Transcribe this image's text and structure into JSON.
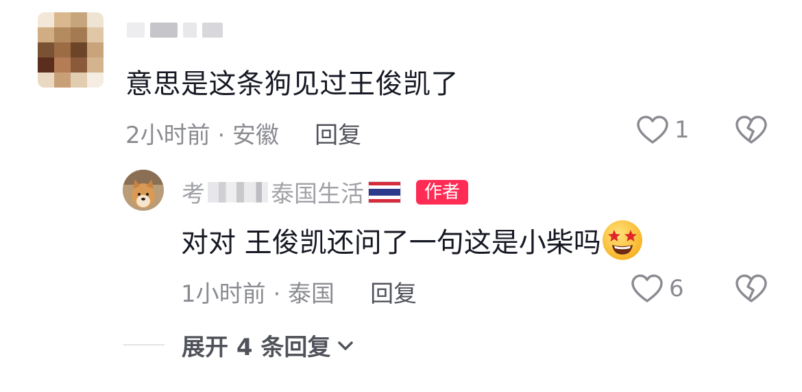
{
  "comment": {
    "text": "意思是这条狗见过王俊凯了",
    "time_location": "2小时前 · 安徽",
    "reply_label": "回复",
    "like_count": "1"
  },
  "reply": {
    "author_prefix": "考",
    "author_suffix": "泰国生活",
    "author_badge": "作者",
    "text": "对对 王俊凯还问了一句这是小柴吗",
    "time_location": "1小时前 · 泰国",
    "reply_label": "回复",
    "like_count": "6"
  },
  "expand": {
    "label": "展开 4 条回复"
  },
  "icons": {
    "like": "heart-outline-icon",
    "dislike": "broken-heart-icon",
    "expand": "chevron-down-icon",
    "flag": "thailand-flag-icon",
    "emoji": "star-struck-emoji-icon"
  },
  "colors": {
    "badge": "#fe2c55",
    "primary_text": "#161823",
    "secondary_text": "#8a8b91"
  }
}
